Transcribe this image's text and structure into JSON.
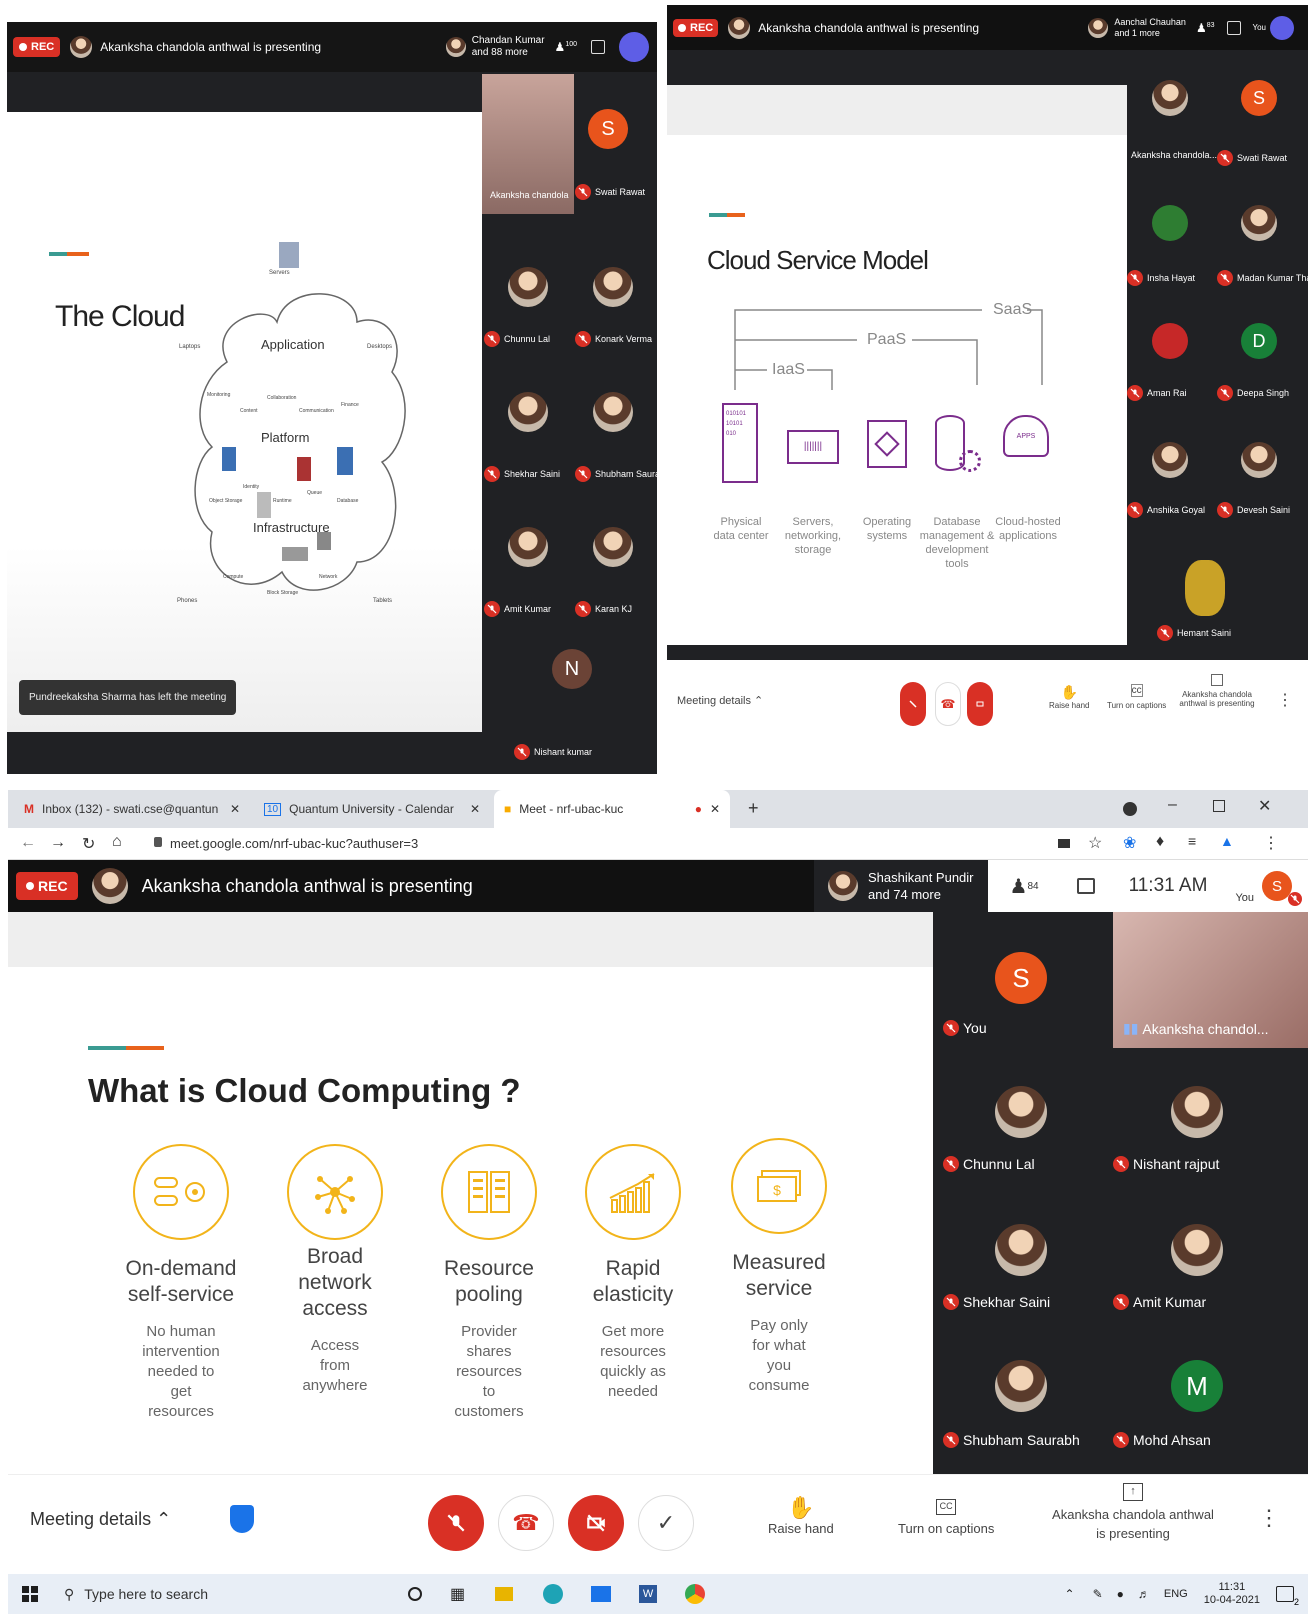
{
  "colors": {
    "rec": "#d93025",
    "dark": "#202124",
    "accent_teal": "#3a9b92",
    "accent_orange": "#e8621c",
    "feature_gold": "#f2b41a"
  },
  "s1": {
    "rec": "REC",
    "presenting": "Akanksha chandola anthwal is presenting",
    "others_name": "Chandan Kumar",
    "others_more": "and 88 more",
    "people_count": "100",
    "slide_title": "The Cloud",
    "cloud_labels": {
      "application": "Application",
      "platform": "Platform",
      "infrastructure": "Infrastructure",
      "servers": "Servers",
      "laptops": "Laptops",
      "desktops": "Desktops",
      "phones": "Phones",
      "tablets": "Tablets",
      "monitoring": "Monitoring",
      "content": "Content",
      "collaboration": "Collaboration",
      "communication": "Communication",
      "finance": "Finance",
      "object_storage": "Object Storage",
      "identity": "Identity",
      "runtime": "Runtime",
      "queue": "Queue",
      "database": "Database",
      "compute": "Compute",
      "block_storage": "Block Storage",
      "network": "Network"
    },
    "toast": "Pundreekaksha Sharma has left the meeting",
    "participants": [
      "Akanksha chandola",
      "Swati Rawat",
      "Chunnu Lal",
      "Konark Verma",
      "Shekhar Saini",
      "Shubham Saurabh",
      "Amit Kumar",
      "Karan KJ",
      "Nishant kumar"
    ],
    "initials": {
      "swati": "S",
      "nishant": "N"
    }
  },
  "s2": {
    "rec": "REC",
    "presenting": "Akanksha chandola anthwal is presenting",
    "others_name": "Aanchal Chauhan",
    "others_more": "and 1 more",
    "people_count": "83",
    "you": "You",
    "slide_title": "Cloud Service Model",
    "layers": {
      "saas": "SaaS",
      "paas": "PaaS",
      "iaas": "IaaS"
    },
    "boxes": [
      {
        "l1": "Physical",
        "l2": "data center",
        "l3": ""
      },
      {
        "l1": "Servers,",
        "l2": "networking,",
        "l3": "storage"
      },
      {
        "l1": "Operating",
        "l2": "systems",
        "l3": ""
      },
      {
        "l1": "Database",
        "l2": "management &",
        "l3": "development tools"
      },
      {
        "l1": "Cloud-hosted",
        "l2": "applications",
        "l3": ""
      }
    ],
    "apps_tag": "APPS",
    "participants": [
      "Akanksha chandola...",
      "Swati Rawat",
      "Insha Hayat",
      "Madan Kumar Thak...",
      "Aman Rai",
      "Deepa Singh",
      "Anshika Goyal",
      "Devesh Saini",
      "Hemant Saini"
    ],
    "initials": {
      "swati": "S",
      "deepa": "D"
    },
    "meeting_details": "Meeting details",
    "raise_hand": "Raise hand",
    "captions": "Turn on captions",
    "presenting_btn": "Akanksha chandola anthwal is presenting"
  },
  "browser": {
    "tabs": [
      {
        "label": "Inbox (132) - swati.cse@quantun",
        "icon": "gmail-icon"
      },
      {
        "label": "Quantum University - Calendar",
        "icon": "calendar-icon"
      },
      {
        "label": "Meet - nrf-ubac-kuc",
        "icon": "meet-icon"
      }
    ],
    "url": "meet.google.com/nrf-ubac-kuc?authuser=3"
  },
  "s3": {
    "rec": "REC",
    "presenting": "Akanksha chandola anthwal is presenting",
    "others_name": "Shashikant Pundir",
    "others_more": "and 74 more",
    "people_count": "84",
    "time": "11:31 AM",
    "you": "You",
    "you_initial": "S",
    "slide_title": "What is Cloud Computing ?",
    "features": [
      {
        "t": [
          "On-demand",
          "self-service"
        ],
        "d": [
          "No human",
          "intervention",
          "needed to",
          "get",
          "resources"
        ]
      },
      {
        "t": [
          "Broad",
          "network",
          "access"
        ],
        "d": [
          "Access",
          "from",
          "anywhere"
        ]
      },
      {
        "t": [
          "Resource",
          "pooling"
        ],
        "d": [
          "Provider",
          "shares",
          "resources",
          "to",
          "customers"
        ]
      },
      {
        "t": [
          "Rapid",
          "elasticity"
        ],
        "d": [
          "Get more",
          "resources",
          "quickly as",
          "needed"
        ]
      },
      {
        "t": [
          "Measured",
          "service"
        ],
        "d": [
          "Pay only",
          "for what",
          "you",
          "consume"
        ]
      }
    ],
    "participants": [
      {
        "name": "You",
        "initial": "S",
        "color": "#e8541c"
      },
      {
        "name": "Akanksha chandol..."
      },
      {
        "name": "Chunnu Lal"
      },
      {
        "name": "Nishant rajput"
      },
      {
        "name": "Shekhar Saini"
      },
      {
        "name": "Amit Kumar"
      },
      {
        "name": "Shubham Saurabh"
      },
      {
        "name": "Mohd Ahsan",
        "initial": "M",
        "color": "#188038"
      }
    ],
    "meeting_details": "Meeting details",
    "raise_hand": "Raise hand",
    "captions": "Turn on captions",
    "presenting_l1": "Akanksha chandola anthwal",
    "presenting_l2": "is presenting"
  },
  "taskbar": {
    "search": "Type here to search",
    "lang": "ENG",
    "time": "11:31",
    "date": "10-04-2021",
    "notif": "2"
  }
}
